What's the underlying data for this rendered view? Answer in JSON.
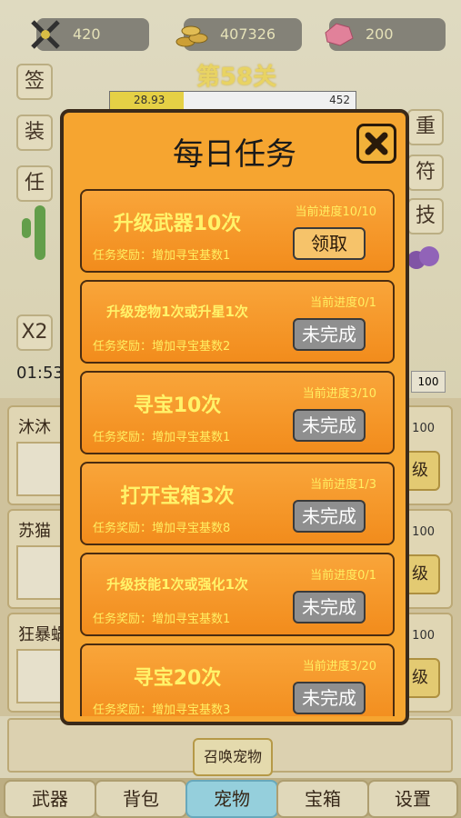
{
  "resources": {
    "weapon_count": "420",
    "coins": "407326",
    "gems": "200"
  },
  "side_left": [
    "签",
    "装",
    "任"
  ],
  "side_right": [
    "重",
    "符",
    "技"
  ],
  "speed_button": "X2",
  "stage": {
    "title": "第58关",
    "hp_current": "28.93",
    "hp_max": "452",
    "hp_fraction": 0.3
  },
  "timer": "01:53",
  "pets": [
    {
      "name": "沐沐",
      "value": "100",
      "action": "级"
    },
    {
      "name": "苏猫",
      "value": "100",
      "action": "级"
    },
    {
      "name": "狂暴蜗",
      "value": "100",
      "action": "级"
    }
  ],
  "right_value": "100",
  "summon_button": "召唤宠物",
  "tabs": [
    "武器",
    "背包",
    "宠物",
    "宝箱",
    "设置"
  ],
  "active_tab": "宠物",
  "dialog": {
    "title": "每日任务",
    "tasks": [
      {
        "name": "升级武器10次",
        "progress": "当前进度10/10",
        "reward": "任务奖励：增加寻宝基数1",
        "button": "领取",
        "status": "claim"
      },
      {
        "name": "升级宠物1次或升星1次",
        "progress": "当前进度0/1",
        "reward": "任务奖励：增加寻宝基数2",
        "button": "未完成",
        "status": "todo"
      },
      {
        "name": "寻宝10次",
        "progress": "当前进度3/10",
        "reward": "任务奖励：增加寻宝基数1",
        "button": "未完成",
        "status": "todo"
      },
      {
        "name": "打开宝箱3次",
        "progress": "当前进度1/3",
        "reward": "任务奖励：增加寻宝基数8",
        "button": "未完成",
        "status": "todo"
      },
      {
        "name": "升级技能1次或强化1次",
        "progress": "当前进度0/1",
        "reward": "任务奖励：增加寻宝基数1",
        "button": "未完成",
        "status": "todo"
      },
      {
        "name": "寻宝20次",
        "progress": "当前进度3/20",
        "reward": "任务奖励：增加寻宝基数3",
        "button": "未完成",
        "status": "todo"
      }
    ]
  },
  "colors": {
    "dialog_bg": "#f6a530",
    "task_text": "#fff36a",
    "active_tab": "#9fdcea"
  }
}
